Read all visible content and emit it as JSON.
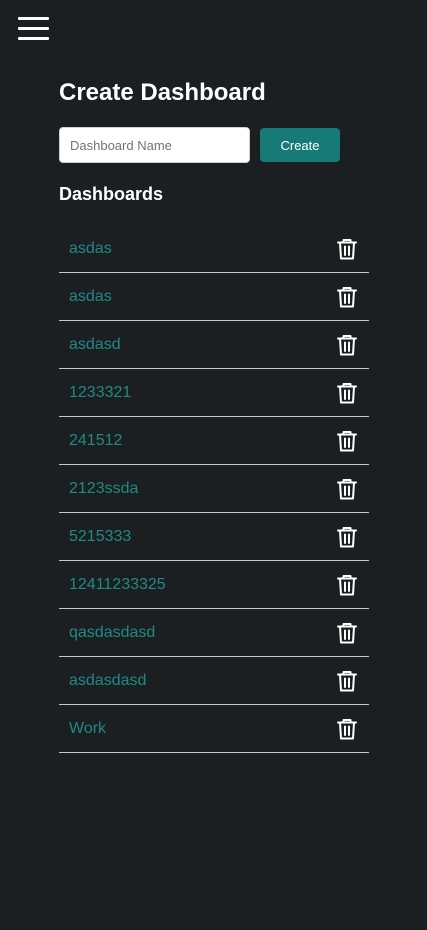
{
  "menu": {
    "icon": "hamburger-menu-icon"
  },
  "create": {
    "title": "Create Dashboard",
    "input_placeholder": "Dashboard Name",
    "input_value": "",
    "button_label": "Create"
  },
  "dashboards": {
    "title": "Dashboards",
    "delete_icon": "trash-icon",
    "items": [
      "asdas",
      "asdas",
      "asdasd",
      "1233321",
      "241512",
      "2123ssda",
      "5215333",
      "12411233325",
      "qasdasdasd",
      "asdasdasd",
      "Work"
    ]
  },
  "colors": {
    "background": "#1c1f22",
    "accent": "#167a76",
    "link": "#1f8a85",
    "divider": "#c8c8c8"
  }
}
